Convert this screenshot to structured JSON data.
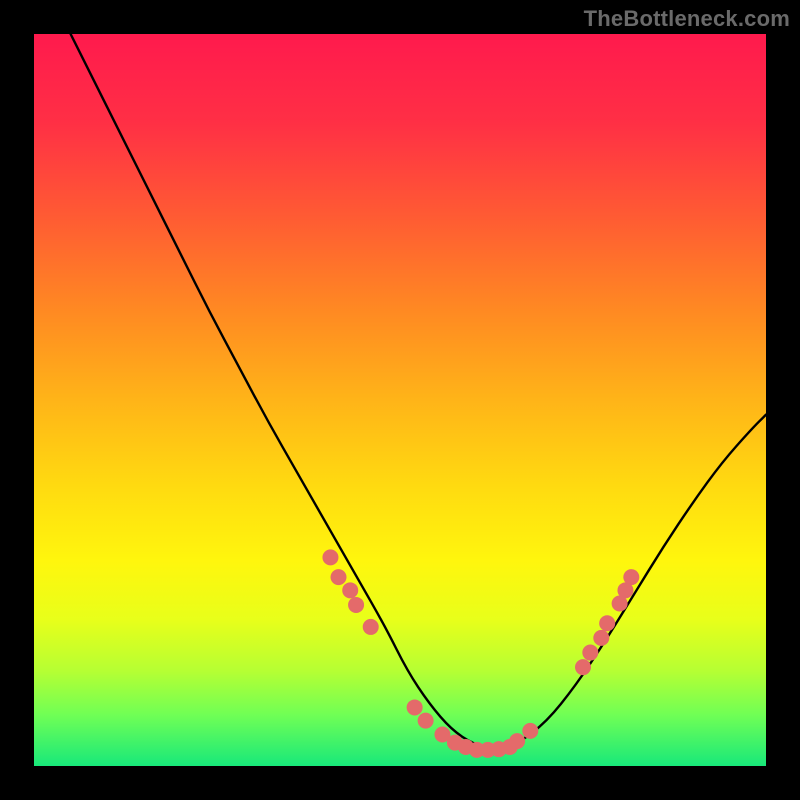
{
  "watermark": "TheBottleneck.com",
  "chart_data": {
    "type": "line",
    "title": "",
    "xlabel": "",
    "ylabel": "",
    "xlim": [
      0,
      100
    ],
    "ylim": [
      0,
      100
    ],
    "grid": false,
    "series": [
      {
        "name": "curve",
        "color": "#000000",
        "x": [
          5,
          8,
          12,
          16,
          20,
          24,
          28,
          32,
          36,
          40,
          44,
          48,
          51,
          54,
          57,
          60,
          63,
          66,
          70,
          74,
          78,
          82,
          86,
          90,
          94,
          98,
          100
        ],
        "y": [
          100,
          94,
          86,
          78,
          70,
          62,
          54.5,
          47,
          40,
          33,
          26,
          19,
          13,
          8.5,
          5,
          3,
          2.2,
          3,
          6,
          11,
          17,
          23.5,
          30,
          36,
          41.5,
          46,
          48
        ]
      }
    ],
    "dots": {
      "color": "#e46a6a",
      "radius": 8,
      "points": [
        {
          "x": 40.5,
          "y": 28.5
        },
        {
          "x": 41.6,
          "y": 25.8
        },
        {
          "x": 43.2,
          "y": 24.0
        },
        {
          "x": 44.0,
          "y": 22.0
        },
        {
          "x": 46.0,
          "y": 19.0
        },
        {
          "x": 52.0,
          "y": 8.0
        },
        {
          "x": 53.5,
          "y": 6.2
        },
        {
          "x": 55.8,
          "y": 4.3
        },
        {
          "x": 57.5,
          "y": 3.2
        },
        {
          "x": 59.0,
          "y": 2.6
        },
        {
          "x": 60.5,
          "y": 2.2
        },
        {
          "x": 62.0,
          "y": 2.2
        },
        {
          "x": 63.5,
          "y": 2.3
        },
        {
          "x": 65.0,
          "y": 2.6
        },
        {
          "x": 66.0,
          "y": 3.4
        },
        {
          "x": 67.8,
          "y": 4.8
        },
        {
          "x": 75.0,
          "y": 13.5
        },
        {
          "x": 76.0,
          "y": 15.5
        },
        {
          "x": 77.5,
          "y": 17.5
        },
        {
          "x": 78.3,
          "y": 19.5
        },
        {
          "x": 80.0,
          "y": 22.2
        },
        {
          "x": 80.8,
          "y": 24.0
        },
        {
          "x": 81.6,
          "y": 25.8
        }
      ]
    },
    "gradient_stops": [
      {
        "offset": 0.0,
        "color": "#ff1a4d"
      },
      {
        "offset": 0.12,
        "color": "#ff2f45"
      },
      {
        "offset": 0.25,
        "color": "#ff5b33"
      },
      {
        "offset": 0.38,
        "color": "#ff8a22"
      },
      {
        "offset": 0.5,
        "color": "#ffb418"
      },
      {
        "offset": 0.62,
        "color": "#ffdb10"
      },
      {
        "offset": 0.72,
        "color": "#fff60d"
      },
      {
        "offset": 0.8,
        "color": "#e8ff1a"
      },
      {
        "offset": 0.87,
        "color": "#b6ff33"
      },
      {
        "offset": 0.93,
        "color": "#70ff55"
      },
      {
        "offset": 1.0,
        "color": "#18e87a"
      }
    ]
  }
}
